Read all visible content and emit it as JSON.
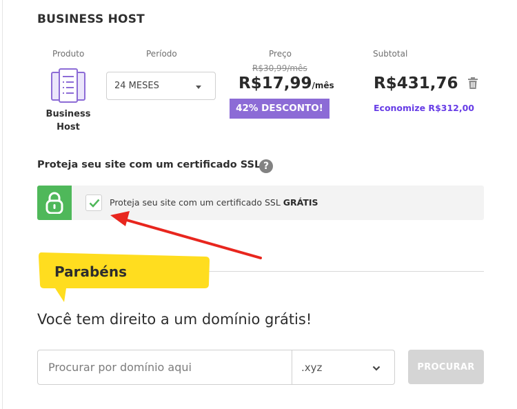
{
  "section": {
    "title": "BUSINESS HOST"
  },
  "columns": {
    "product": "Produto",
    "period": "Período",
    "price": "Preço",
    "subtotal": "Subtotal"
  },
  "product": {
    "name_line1": "Business",
    "name_line2": "Host",
    "icon": "server-icon"
  },
  "period": {
    "selected": "24 MESES"
  },
  "price": {
    "original": "R$30,99/mês",
    "current": "R$17,99",
    "unit": "/mês",
    "discount": "42% DESCONTO!"
  },
  "subtotal": {
    "value": "R$431,76",
    "savings": "Economize R$312,00"
  },
  "ssl": {
    "heading": "Proteja seu site com um certificado SSL",
    "help_symbol": "?",
    "label": "Proteja seu site com um certificado SSL",
    "label_bold": "GRÁTIS",
    "checked": true
  },
  "promo": {
    "tag": "Parabéns",
    "heading": "Você tem direito a um domínio grátis!"
  },
  "domain_search": {
    "placeholder": "Procurar por domínio aqui",
    "tld": ".xyz",
    "button": "PROCURAR"
  },
  "colors": {
    "accent_purple": "#673de6",
    "badge_purple": "#8c6bd6",
    "ssl_green": "#4fb85a",
    "promo_yellow": "#ffdd1f",
    "annotation_red": "#e8261e",
    "button_disabled": "#d5d5d5"
  }
}
